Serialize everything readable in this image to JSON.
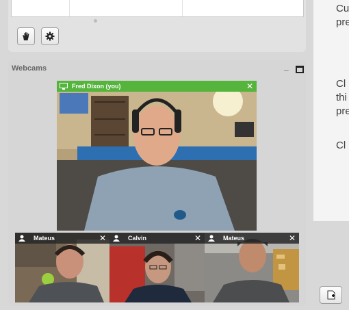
{
  "top_panel": {
    "buttons": [
      {
        "icon": "raise-hand-icon"
      },
      {
        "icon": "gear-icon"
      }
    ]
  },
  "webcams": {
    "title": "Webcams",
    "main_video": {
      "name": "Fred Dixon (you)",
      "close": "✕",
      "bar_color": "#55b43c"
    },
    "small_videos": [
      {
        "name": "Mateus",
        "close": "✕"
      },
      {
        "name": "Calvin",
        "close": "✕"
      },
      {
        "name": "Mateus",
        "close": "✕"
      }
    ]
  },
  "right_panel": {
    "lines": [
      "Cu",
      "pre",
      "Cl",
      "thi",
      "pre",
      "Cl"
    ]
  },
  "colors": {
    "bar_green": "#55b43c",
    "panel_bg": "#d6d6d6"
  }
}
